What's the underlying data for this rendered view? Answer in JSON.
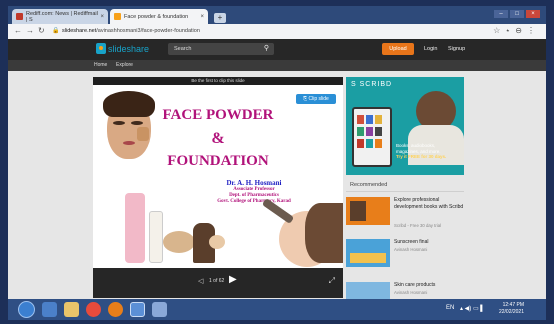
{
  "browser": {
    "tabs": [
      {
        "title": "Rediff.com: News | Rediffmail | S",
        "active": false,
        "favicon_color": "#c0392b"
      },
      {
        "title": "Face powder & foundation",
        "active": true,
        "favicon_color": "#f7a11a"
      }
    ],
    "new_tab_label": "+",
    "url_prefix": "slideshare.net",
    "url_rest": "/avinashhosmani3/face-powder-foundation",
    "close_glyph": "×"
  },
  "slideshare": {
    "logo_text": "slideshare",
    "search_placeholder": "Search",
    "upload_label": "Upload",
    "login_label": "Login",
    "signup_label": "Signup",
    "subnav": [
      "Home",
      "Explore"
    ]
  },
  "slide": {
    "top_notice": "Be the first to clip this slide",
    "clip_label": "Clip slide",
    "title_line1": "FACE POWDER",
    "title_amp": "&",
    "title_line2": "FOUNDATION",
    "author_name": "Dr. A. H. Hosmani",
    "author_lines": [
      "Associate Professor",
      "Dept. of Pharmaceutics",
      "Govt. College of Pharmacy, Karad"
    ],
    "page_counter": "1 of 62"
  },
  "sidebar": {
    "ad_brand": "S SCRIBD",
    "ad_text_1": "Books, audiobooks,",
    "ad_text_2": "magazines, and more.",
    "ad_text_3": "Try it",
    "ad_text_4": "FREE for 30 days.",
    "recommended_title": "Recommended",
    "items": [
      {
        "title": "Explore professional development books with Scribd",
        "meta": "Scribd - Free 30 day trial",
        "thumb_color": "#e87e1a"
      },
      {
        "title": "Sunscreen final",
        "meta": "Avinash Hosmani",
        "thumb_color": "#4aa2d8"
      },
      {
        "title": "Skin care products",
        "meta": "Avinash Hosmani",
        "thumb_color": "#7fb7e0"
      }
    ]
  },
  "taskbar": {
    "lang": "EN",
    "time": "12:47 PM",
    "date": "22/02/2021"
  }
}
